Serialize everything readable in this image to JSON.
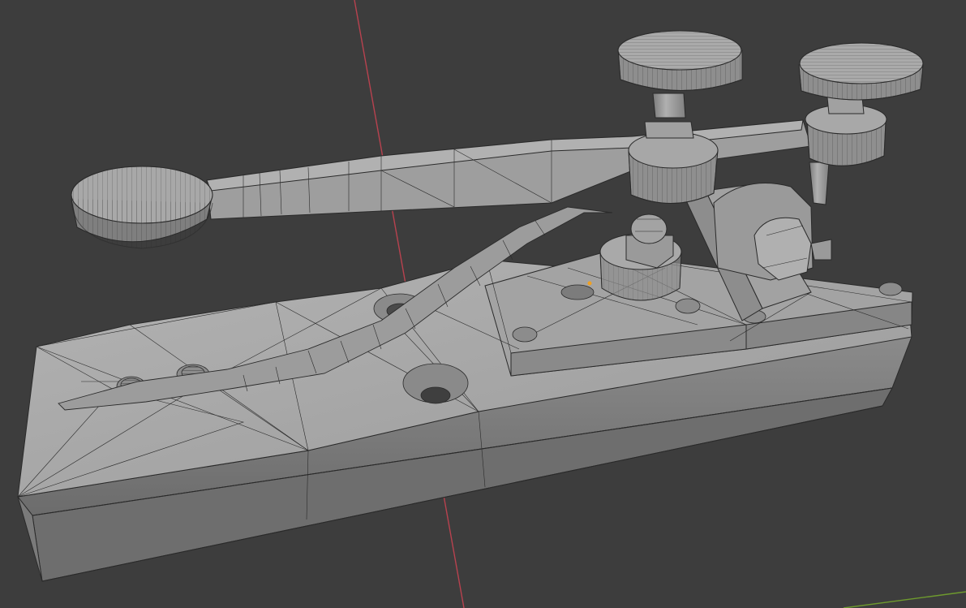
{
  "viewport": {
    "background": "#3d3d3d",
    "y_axis_color": "#b8424f",
    "x_axis_color": "#6e9a2e",
    "wire_color": "#2a2a2a",
    "mesh_light": "#a9a9a9",
    "mesh_mid": "#8f8f8f",
    "mesh_dark": "#6f6f6f",
    "origin_color": "#f0a020"
  },
  "object": {
    "icon": "telegraph-key-mesh"
  }
}
